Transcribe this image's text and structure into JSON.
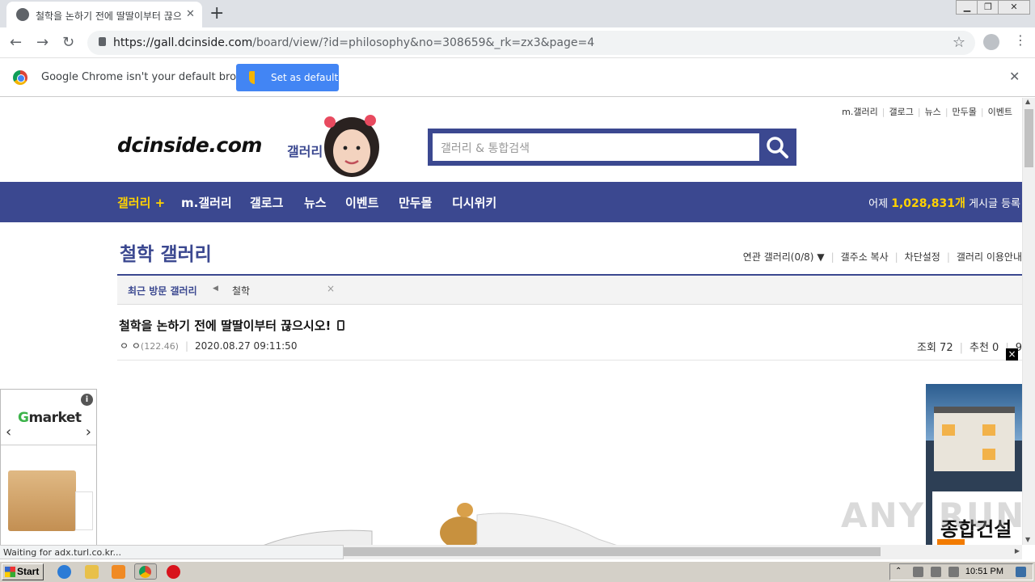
{
  "browser": {
    "tab_title": "철학을 논하기 전에 딸딸이부터 끊으",
    "new_tab": "+",
    "url_host": "https://gall.dcinside.com",
    "url_path": "/board/view/?id=philosophy&no=308659&_rk=zx3&page=4",
    "infobar_message": "Google Chrome isn't your default browser",
    "set_default_label": "Set as default"
  },
  "site": {
    "top_links": [
      "m.갤러리",
      "갤로그",
      "뉴스",
      "만두몰",
      "이벤트"
    ],
    "logo": "dcinside.com",
    "logo_sub": "갤러리",
    "search_placeholder": "갤러리 & 통합검색",
    "nav_items": [
      "갤러리 +",
      "m.갤러리",
      "갤로그",
      "뉴스",
      "이벤트",
      "만두몰",
      "디시위키"
    ],
    "count_prefix": "어제",
    "count_value": "1,028,831개",
    "count_suffix": "게시글 등록"
  },
  "gallery": {
    "title": "철학 갤러리",
    "menu": [
      "연관 갤러리(0/8)",
      "갤주소 복사",
      "차단설정",
      "갤러리 이용안내"
    ],
    "recent_label": "최근 방문 갤러리",
    "recent_item": "철학",
    "recent_close": "×"
  },
  "post": {
    "title": "철학을 논하기 전에 딸딸이부터 끊으시오!",
    "author": "ㅇ ㅇ",
    "ip": "(122.46)",
    "datetime": "2020.08.27 09:11:50",
    "views_label": "조회 72",
    "recommend_label": "추천 0",
    "comments_label": "9"
  },
  "ads": {
    "left_brand_g": "G",
    "left_brand_rest": "market",
    "info": "i",
    "close": "×",
    "right_text": "종합건설"
  },
  "watermark": "ANY RUN",
  "status_text": "Waiting for adx.turl.co.kr...",
  "taskbar": {
    "start_label": "Start",
    "time": "10:51 PM"
  }
}
